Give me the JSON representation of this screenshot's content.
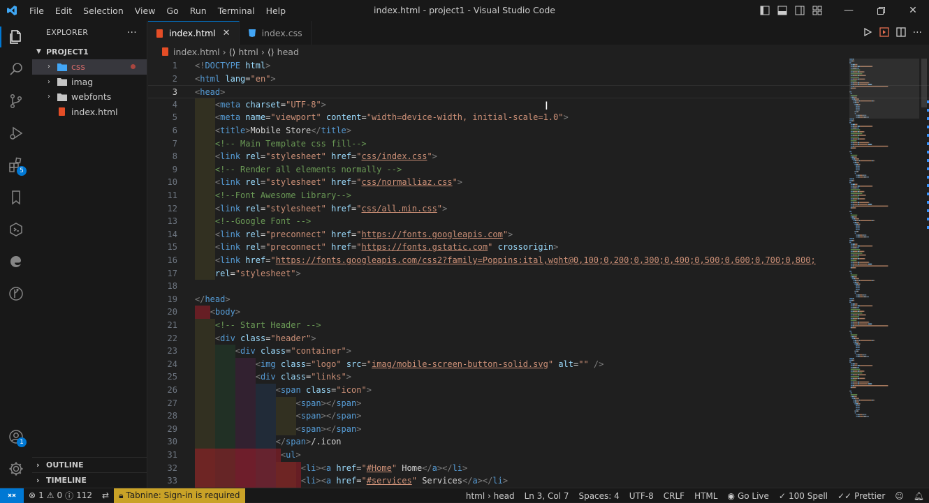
{
  "window": {
    "title": "index.html - project1 - Visual Studio Code",
    "menu": [
      "File",
      "Edit",
      "Selection",
      "View",
      "Go",
      "Run",
      "Terminal",
      "Help"
    ]
  },
  "activity_bar": {
    "extensions_badge": "5",
    "accounts_badge": "1"
  },
  "sidebar": {
    "header": "EXPLORER",
    "more": "···",
    "project": "PROJECT1",
    "items": [
      {
        "label": "css",
        "type": "folder"
      },
      {
        "label": "imag",
        "type": "folder"
      },
      {
        "label": "webfonts",
        "type": "folder"
      },
      {
        "label": "index.html",
        "type": "file"
      }
    ],
    "outline": "OUTLINE",
    "timeline": "TIMELINE"
  },
  "tabs": [
    {
      "label": "index.html",
      "close": "✕"
    },
    {
      "label": "index.css"
    }
  ],
  "breadcrumb": [
    "index.html",
    "html",
    "head"
  ],
  "code_lines": [
    [
      [
        "t",
        "<!"
      ],
      [
        "n",
        "DOCTYPE"
      ],
      [
        "x",
        " "
      ],
      [
        "a",
        "html"
      ],
      [
        "t",
        ">"
      ]
    ],
    [
      [
        "t",
        "<"
      ],
      [
        "n",
        "html"
      ],
      [
        "x",
        " "
      ],
      [
        "a",
        "lang"
      ],
      [
        "x",
        "="
      ],
      [
        "s",
        "\"en\""
      ],
      [
        "t",
        ">"
      ]
    ],
    [
      [
        "t",
        "<"
      ],
      [
        "n",
        "head"
      ],
      [
        "t",
        ">"
      ]
    ],
    [
      [
        "x",
        "    "
      ],
      [
        "t",
        "<"
      ],
      [
        "n",
        "meta"
      ],
      [
        "x",
        " "
      ],
      [
        "a",
        "charset"
      ],
      [
        "x",
        "="
      ],
      [
        "s",
        "\"UTF-8\""
      ],
      [
        "t",
        ">"
      ]
    ],
    [
      [
        "x",
        "    "
      ],
      [
        "t",
        "<"
      ],
      [
        "n",
        "meta"
      ],
      [
        "x",
        " "
      ],
      [
        "a",
        "name"
      ],
      [
        "x",
        "="
      ],
      [
        "s",
        "\"viewport\""
      ],
      [
        "x",
        " "
      ],
      [
        "a",
        "content"
      ],
      [
        "x",
        "="
      ],
      [
        "s",
        "\"width=device-width, initial-scale=1.0\""
      ],
      [
        "t",
        ">"
      ]
    ],
    [
      [
        "x",
        "    "
      ],
      [
        "t",
        "<"
      ],
      [
        "n",
        "title"
      ],
      [
        "t",
        ">"
      ],
      [
        "x",
        "Mobile Store"
      ],
      [
        "t",
        "</"
      ],
      [
        "n",
        "title"
      ],
      [
        "t",
        ">"
      ]
    ],
    [
      [
        "x",
        "    "
      ],
      [
        "c",
        "<!-- Main Template css fill-->"
      ]
    ],
    [
      [
        "x",
        "    "
      ],
      [
        "t",
        "<"
      ],
      [
        "n",
        "link"
      ],
      [
        "x",
        " "
      ],
      [
        "a",
        "rel"
      ],
      [
        "x",
        "="
      ],
      [
        "s",
        "\"stylesheet\""
      ],
      [
        "x",
        " "
      ],
      [
        "a",
        "href"
      ],
      [
        "x",
        "="
      ],
      [
        "s",
        "\""
      ],
      [
        "su",
        "css/index.css"
      ],
      [
        "s",
        "\""
      ],
      [
        "t",
        ">"
      ]
    ],
    [
      [
        "x",
        "    "
      ],
      [
        "c",
        "<!-- Render all elements normally -->"
      ]
    ],
    [
      [
        "x",
        "    "
      ],
      [
        "t",
        "<"
      ],
      [
        "n",
        "link"
      ],
      [
        "x",
        " "
      ],
      [
        "a",
        "rel"
      ],
      [
        "x",
        "="
      ],
      [
        "s",
        "\"stylesheet\""
      ],
      [
        "x",
        " "
      ],
      [
        "a",
        "href"
      ],
      [
        "x",
        "="
      ],
      [
        "s",
        "\""
      ],
      [
        "su",
        "css/normalliaz.css"
      ],
      [
        "s",
        "\""
      ],
      [
        "t",
        ">"
      ]
    ],
    [
      [
        "x",
        "    "
      ],
      [
        "c",
        "<!--Font Awesome Library-->"
      ]
    ],
    [
      [
        "x",
        "    "
      ],
      [
        "t",
        "<"
      ],
      [
        "n",
        "link"
      ],
      [
        "x",
        " "
      ],
      [
        "a",
        "rel"
      ],
      [
        "x",
        "="
      ],
      [
        "s",
        "\"stylesheet\""
      ],
      [
        "x",
        " "
      ],
      [
        "a",
        "href"
      ],
      [
        "x",
        "="
      ],
      [
        "s",
        "\""
      ],
      [
        "su",
        "css/all.min.css"
      ],
      [
        "s",
        "\""
      ],
      [
        "t",
        ">"
      ]
    ],
    [
      [
        "x",
        "    "
      ],
      [
        "c",
        "<!--Google Font -->"
      ]
    ],
    [
      [
        "x",
        "    "
      ],
      [
        "t",
        "<"
      ],
      [
        "n",
        "link"
      ],
      [
        "x",
        " "
      ],
      [
        "a",
        "rel"
      ],
      [
        "x",
        "="
      ],
      [
        "s",
        "\"preconnect\""
      ],
      [
        "x",
        " "
      ],
      [
        "a",
        "href"
      ],
      [
        "x",
        "="
      ],
      [
        "s",
        "\""
      ],
      [
        "su",
        "https://fonts.googleapis.com"
      ],
      [
        "s",
        "\""
      ],
      [
        "t",
        ">"
      ]
    ],
    [
      [
        "x",
        "    "
      ],
      [
        "t",
        "<"
      ],
      [
        "n",
        "link"
      ],
      [
        "x",
        " "
      ],
      [
        "a",
        "rel"
      ],
      [
        "x",
        "="
      ],
      [
        "s",
        "\"preconnect\""
      ],
      [
        "x",
        " "
      ],
      [
        "a",
        "href"
      ],
      [
        "x",
        "="
      ],
      [
        "s",
        "\""
      ],
      [
        "su",
        "https://fonts.gstatic.com"
      ],
      [
        "s",
        "\""
      ],
      [
        "x",
        " "
      ],
      [
        "a",
        "crossorigin"
      ],
      [
        "t",
        ">"
      ]
    ],
    [
      [
        "x",
        "    "
      ],
      [
        "t",
        "<"
      ],
      [
        "n",
        "link"
      ],
      [
        "x",
        " "
      ],
      [
        "a",
        "href"
      ],
      [
        "x",
        "="
      ],
      [
        "s",
        "\""
      ],
      [
        "su",
        "https://fonts.googleapis.com/css2?family=Poppins:ital,wght@0,100;0,200;0,300;0,400;0,500;0,600;0,700;0,800;"
      ]
    ],
    [
      [
        "x",
        "    "
      ],
      [
        "a",
        "rel"
      ],
      [
        "x",
        "="
      ],
      [
        "s",
        "\"stylesheet\""
      ],
      [
        "t",
        ">"
      ]
    ],
    [
      [
        "x",
        ""
      ]
    ],
    [
      [
        "t",
        "</"
      ],
      [
        "n",
        "head"
      ],
      [
        "t",
        ">"
      ]
    ],
    [
      [
        "x",
        "   "
      ],
      [
        "t",
        "<"
      ],
      [
        "n",
        "body"
      ],
      [
        "t",
        ">"
      ]
    ],
    [
      [
        "x",
        "    "
      ],
      [
        "c",
        "<!-- Start Header -->"
      ]
    ],
    [
      [
        "x",
        "    "
      ],
      [
        "t",
        "<"
      ],
      [
        "n",
        "div"
      ],
      [
        "x",
        " "
      ],
      [
        "a",
        "class"
      ],
      [
        "x",
        "="
      ],
      [
        "s",
        "\"header\""
      ],
      [
        "t",
        ">"
      ]
    ],
    [
      [
        "x",
        "        "
      ],
      [
        "t",
        "<"
      ],
      [
        "n",
        "div"
      ],
      [
        "x",
        " "
      ],
      [
        "a",
        "class"
      ],
      [
        "x",
        "="
      ],
      [
        "s",
        "\"container\""
      ],
      [
        "t",
        ">"
      ]
    ],
    [
      [
        "x",
        "            "
      ],
      [
        "t",
        "<"
      ],
      [
        "n",
        "img"
      ],
      [
        "x",
        " "
      ],
      [
        "a",
        "class"
      ],
      [
        "x",
        "="
      ],
      [
        "s",
        "\"logo\""
      ],
      [
        "x",
        " "
      ],
      [
        "a",
        "src"
      ],
      [
        "x",
        "="
      ],
      [
        "s",
        "\""
      ],
      [
        "su",
        "imag/mobile-screen-button-solid.svg"
      ],
      [
        "s",
        "\""
      ],
      [
        "x",
        " "
      ],
      [
        "a",
        "alt"
      ],
      [
        "x",
        "="
      ],
      [
        "s",
        "\"\""
      ],
      [
        "x",
        " "
      ],
      [
        "t",
        "/>"
      ]
    ],
    [
      [
        "x",
        "            "
      ],
      [
        "t",
        "<"
      ],
      [
        "n",
        "div"
      ],
      [
        "x",
        " "
      ],
      [
        "a",
        "class"
      ],
      [
        "x",
        "="
      ],
      [
        "s",
        "\"links\""
      ],
      [
        "t",
        ">"
      ]
    ],
    [
      [
        "x",
        "                "
      ],
      [
        "t",
        "<"
      ],
      [
        "n",
        "span"
      ],
      [
        "x",
        " "
      ],
      [
        "a",
        "class"
      ],
      [
        "x",
        "="
      ],
      [
        "s",
        "\"icon\""
      ],
      [
        "t",
        ">"
      ]
    ],
    [
      [
        "x",
        "                    "
      ],
      [
        "t",
        "<"
      ],
      [
        "n",
        "span"
      ],
      [
        "t",
        "></"
      ],
      [
        "n",
        "span"
      ],
      [
        "t",
        ">"
      ]
    ],
    [
      [
        "x",
        "                    "
      ],
      [
        "t",
        "<"
      ],
      [
        "n",
        "span"
      ],
      [
        "t",
        "></"
      ],
      [
        "n",
        "span"
      ],
      [
        "t",
        ">"
      ]
    ],
    [
      [
        "x",
        "                    "
      ],
      [
        "t",
        "<"
      ],
      [
        "n",
        "span"
      ],
      [
        "t",
        "></"
      ],
      [
        "n",
        "span"
      ],
      [
        "t",
        ">"
      ]
    ],
    [
      [
        "x",
        "                "
      ],
      [
        "t",
        "</"
      ],
      [
        "n",
        "span"
      ],
      [
        "t",
        ">"
      ],
      [
        "x",
        "/.icon"
      ]
    ],
    [
      [
        "x",
        "                 "
      ],
      [
        "t",
        "<"
      ],
      [
        "n",
        "ul"
      ],
      [
        "t",
        ">"
      ]
    ],
    [
      [
        "x",
        "                     "
      ],
      [
        "t",
        "<"
      ],
      [
        "n",
        "li"
      ],
      [
        "t",
        "><"
      ],
      [
        "n",
        "a"
      ],
      [
        "x",
        " "
      ],
      [
        "a",
        "href"
      ],
      [
        "x",
        "="
      ],
      [
        "s",
        "\""
      ],
      [
        "su",
        "#Home"
      ],
      [
        "s",
        "\""
      ],
      [
        "x",
        " Home"
      ],
      [
        "t",
        "</"
      ],
      [
        "n",
        "a"
      ],
      [
        "t",
        "></"
      ],
      [
        "n",
        "li"
      ],
      [
        "t",
        ">"
      ]
    ],
    [
      [
        "x",
        "                     "
      ],
      [
        "t",
        "<"
      ],
      [
        "n",
        "li"
      ],
      [
        "t",
        "><"
      ],
      [
        "n",
        "a"
      ],
      [
        "x",
        " "
      ],
      [
        "a",
        "href"
      ],
      [
        "x",
        "="
      ],
      [
        "s",
        "\""
      ],
      [
        "su",
        "#services"
      ],
      [
        "s",
        "\""
      ],
      [
        "x",
        " Services"
      ],
      [
        "t",
        "</"
      ],
      [
        "n",
        "a"
      ],
      [
        "t",
        "></"
      ],
      [
        "n",
        "li"
      ],
      [
        "t",
        ">"
      ]
    ]
  ],
  "status": {
    "errors": "1",
    "warnings": "0",
    "info": "112",
    "tabnine": "Tabnine: Sign-in is required",
    "path": "html › head",
    "position": "Ln 3, Col 7",
    "spaces": "Spaces: 4",
    "encoding": "UTF-8",
    "eol": "CRLF",
    "language": "HTML",
    "golive": "Go Live",
    "spell": "100 Spell",
    "prettier": "Prettier"
  },
  "colors": {
    "accent": "#0078d4",
    "editor_bg": "#1f1f1f",
    "chrome_bg": "#181818"
  }
}
